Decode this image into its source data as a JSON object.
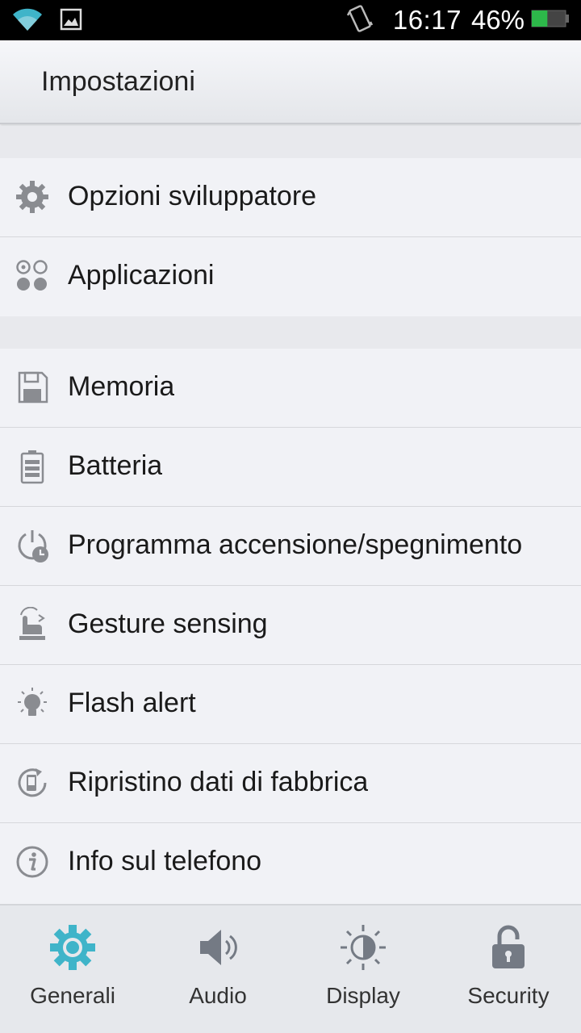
{
  "status_bar": {
    "time": "16:17",
    "battery_percent": "46%",
    "battery_level": 0.46,
    "icons": [
      "wifi-icon",
      "image-notification-icon",
      "vibrate-icon",
      "battery-icon"
    ]
  },
  "app_bar": {
    "title": "Impostazioni"
  },
  "sections": [
    {
      "items": [
        {
          "label": "Opzioni sviluppatore",
          "icon": "gear-icon"
        },
        {
          "label": "Applicazioni",
          "icon": "apps-icon"
        }
      ]
    },
    {
      "items": [
        {
          "label": "Memoria",
          "icon": "storage-icon"
        },
        {
          "label": "Batteria",
          "icon": "battery-icon"
        },
        {
          "label": "Programma accensione/spegnimento",
          "icon": "power-schedule-icon"
        },
        {
          "label": "Gesture sensing",
          "icon": "gesture-icon"
        },
        {
          "label": "Flash alert",
          "icon": "flash-bulb-icon"
        },
        {
          "label": "Ripristino dati di fabbrica",
          "icon": "factory-reset-icon"
        },
        {
          "label": "Info sul telefono",
          "icon": "info-icon"
        }
      ]
    }
  ],
  "tabs": [
    {
      "label": "Generali",
      "icon": "gear-icon",
      "active": true
    },
    {
      "label": "Audio",
      "icon": "speaker-icon",
      "active": false
    },
    {
      "label": "Display",
      "icon": "brightness-icon",
      "active": false
    },
    {
      "label": "Security",
      "icon": "lock-icon",
      "active": false
    }
  ],
  "colors": {
    "accent": "#3fb4c9",
    "icon_gray": "#8a8c91",
    "tab_icon_gray": "#747a84",
    "battery_green": "#2db84a"
  }
}
